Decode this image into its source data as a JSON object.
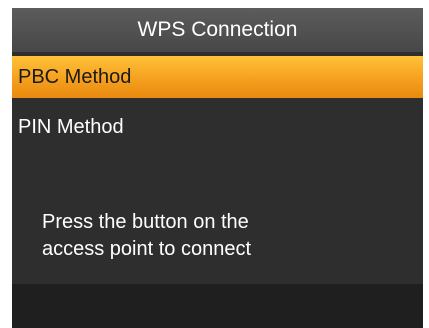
{
  "screen": {
    "title": "WPS Connection"
  },
  "menu": {
    "items": [
      {
        "label": "PBC Method",
        "selected": true
      },
      {
        "label": "PIN Method",
        "selected": false
      }
    ]
  },
  "hint": {
    "line1": "Press the button on the",
    "line2": "access point to connect"
  },
  "colors": {
    "highlight": "#f5a01e",
    "background": "#2e2e2e",
    "title_bar": "#505050"
  }
}
